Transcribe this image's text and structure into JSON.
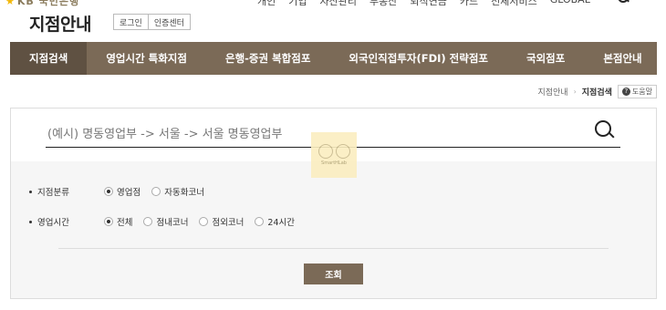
{
  "topbar": {
    "logo_text": "KB 국민은행",
    "links": [
      "개인",
      "기업",
      "자산관리",
      "부동산",
      "퇴직연금",
      "카드",
      "전체서비스",
      "GLOBAL"
    ]
  },
  "header": {
    "title": "지점안내",
    "login_label": "로그인",
    "cert_label": "인증센터"
  },
  "nav": {
    "tabs": [
      {
        "label": "지점검색",
        "active": true
      },
      {
        "label": "영업시간 특화지점",
        "active": false
      },
      {
        "label": "은행-증권 복합점포",
        "active": false
      },
      {
        "label": "외국인직접투자(FDI) 전략점포",
        "active": false
      },
      {
        "label": "국외점포",
        "active": false
      },
      {
        "label": "본점안내",
        "active": false
      }
    ]
  },
  "breadcrumb": {
    "parent": "지점안내",
    "current": "지점검색",
    "help_label": "도움말"
  },
  "search": {
    "placeholder": "(예시) 명동영업부 -> 서울 -> 서울 명동영업부",
    "value": ""
  },
  "watermark": {
    "text": "SmartHLab"
  },
  "filters": {
    "branch_type": {
      "label": "지점분류",
      "options": [
        {
          "label": "영업점",
          "checked": true
        },
        {
          "label": "자동화코너",
          "checked": false
        }
      ]
    },
    "hours": {
      "label": "영업시간",
      "options": [
        {
          "label": "전체",
          "checked": true
        },
        {
          "label": "점내코너",
          "checked": false
        },
        {
          "label": "점외코너",
          "checked": false
        },
        {
          "label": "24시간",
          "checked": false
        }
      ]
    }
  },
  "submit_label": "조회"
}
